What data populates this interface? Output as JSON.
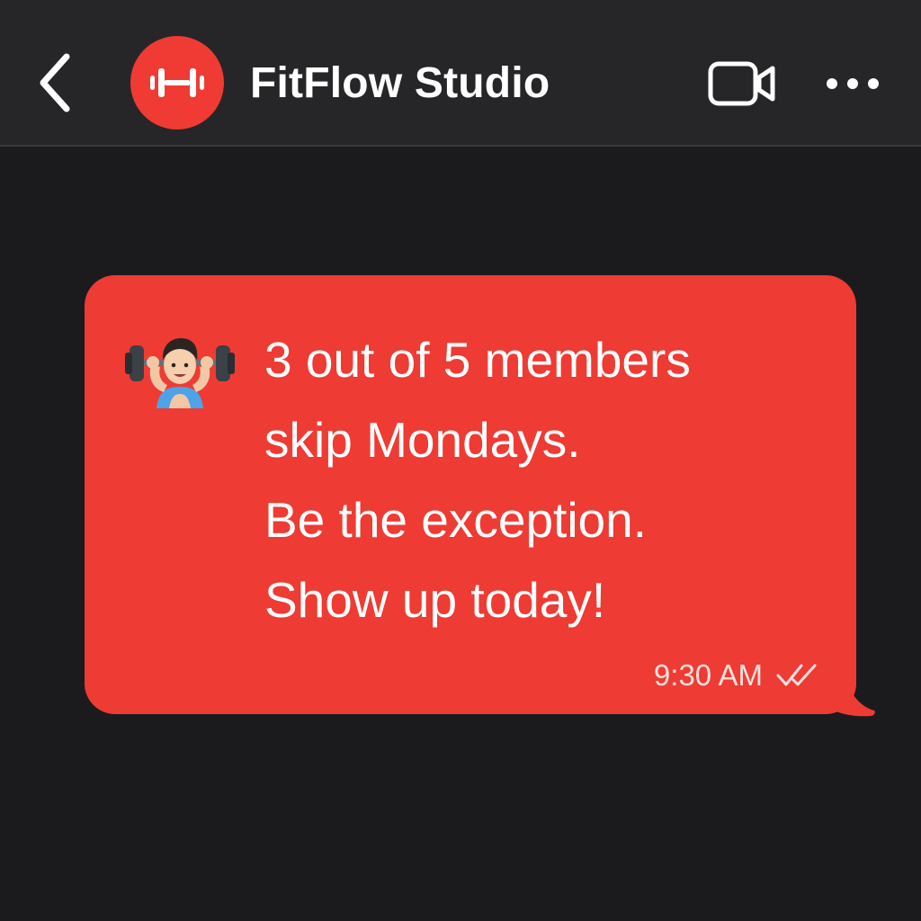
{
  "header": {
    "back_icon": "chevron-left-icon",
    "avatar_icon": "dumbbell-icon",
    "title": "FitFlow Studio",
    "video_icon": "video-camera-icon",
    "more_icon": "more-horizontal-icon"
  },
  "message": {
    "emoji": "person-lifting-weights-emoji",
    "lines": [
      "3 out of 5 members",
      "skip Mondays.",
      "Be the exception.",
      "Show up today!"
    ],
    "time": "9:30 AM",
    "status_icon": "double-check-icon"
  },
  "colors": {
    "background": "#1b1b1d",
    "header": "#262628",
    "accent": "#ee3b33",
    "text": "#ffffff"
  }
}
